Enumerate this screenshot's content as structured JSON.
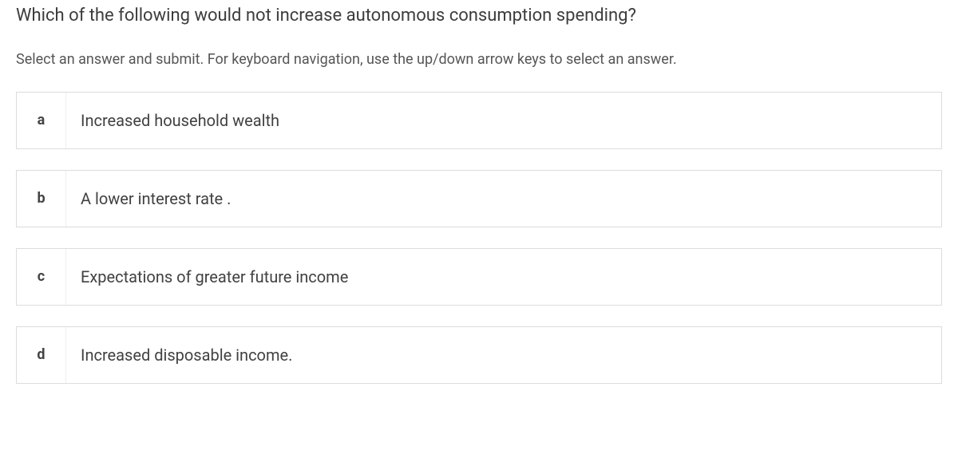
{
  "question": "Which of the following would not increase autonomous consumption spending?",
  "instructions": "Select an answer and submit. For keyboard navigation, use the up/down arrow keys to select an answer.",
  "options": [
    {
      "letter": "a",
      "text": "Increased household wealth"
    },
    {
      "letter": "b",
      "text": "A lower interest rate ."
    },
    {
      "letter": "c",
      "text": "Expectations of greater future income"
    },
    {
      "letter": "d",
      "text": "Increased disposable income."
    }
  ]
}
